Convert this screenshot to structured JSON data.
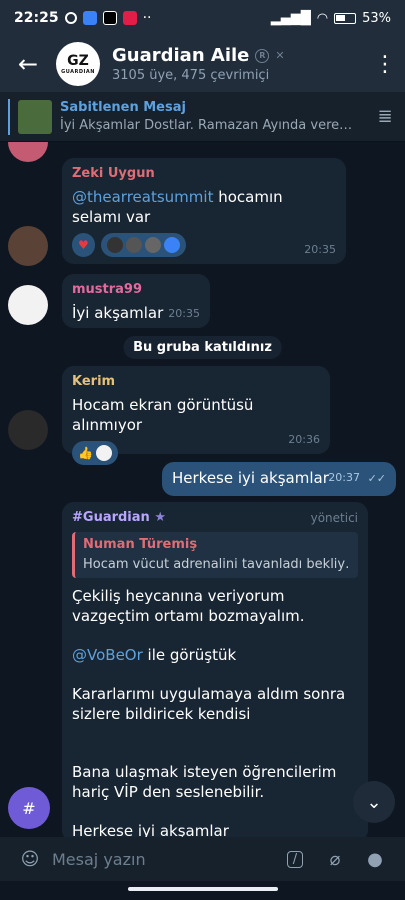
{
  "status": {
    "time": "22:25",
    "battery_text": "53%"
  },
  "header": {
    "back_label": "←",
    "avatar_letters": "GZ",
    "avatar_brand": "GUARDIAN",
    "title": "Guardian Aile",
    "subtitle": "3105 üye, 475 çevrimiçi",
    "menu_label": "⋮"
  },
  "pinned": {
    "title": "Sabitlenen Mesaj",
    "text": "İyi Akşamlar Dostlar.    Ramazan Ayında vere…",
    "list_icon": "pinned-list-icon"
  },
  "messages": [
    {
      "sender": "Zeki Uygun",
      "sender_color": "#e06c75",
      "mention": "@thearreatsummit",
      "text": " hocamın selamı var",
      "time": "20:35"
    },
    {
      "sender": "mustra99",
      "sender_color": "#e06c9f",
      "text": "İyi akşamlar",
      "time": "20:35"
    },
    {
      "service": "Bu gruba katıldınız"
    },
    {
      "sender": "Kerim",
      "sender_color": "#e5c07b",
      "text": "Hocam ekran görüntüsü alınmıyor",
      "time": "20:36"
    },
    {
      "text": "Herkese iyi akşamlar",
      "time": "20:37"
    },
    {
      "sender": "#Guardian",
      "sender_color": "#b9a6ff",
      "role": "yönetici",
      "reply_name": "Numan Türemiş",
      "reply_text": "Hocam vücut adrenalini tavanladı bekliy…",
      "p1": "Çekiliş heycanına veriyorum vazgeçtim ortamı bozmayalım.",
      "p2_mention": "@VoBeOr",
      "p2_text": " ile görüştük",
      "p3": "Kararlarımı uygulamaya aldım sonra sizlere bildiricek kendisi",
      "p4": "Bana ulaşmak isteyen öğrencilerim hariç VİP den seslenebilir.",
      "p5": "Herkese iyi akşamlar"
    }
  ],
  "input": {
    "placeholder": "Mesaj yazın",
    "command_label": "/"
  },
  "fab": {
    "hash_label": "#",
    "down_label": "⌄"
  },
  "colors": {
    "accent": "#5ea1dc",
    "outgoing": "#2b5278",
    "incoming": "#182533"
  }
}
